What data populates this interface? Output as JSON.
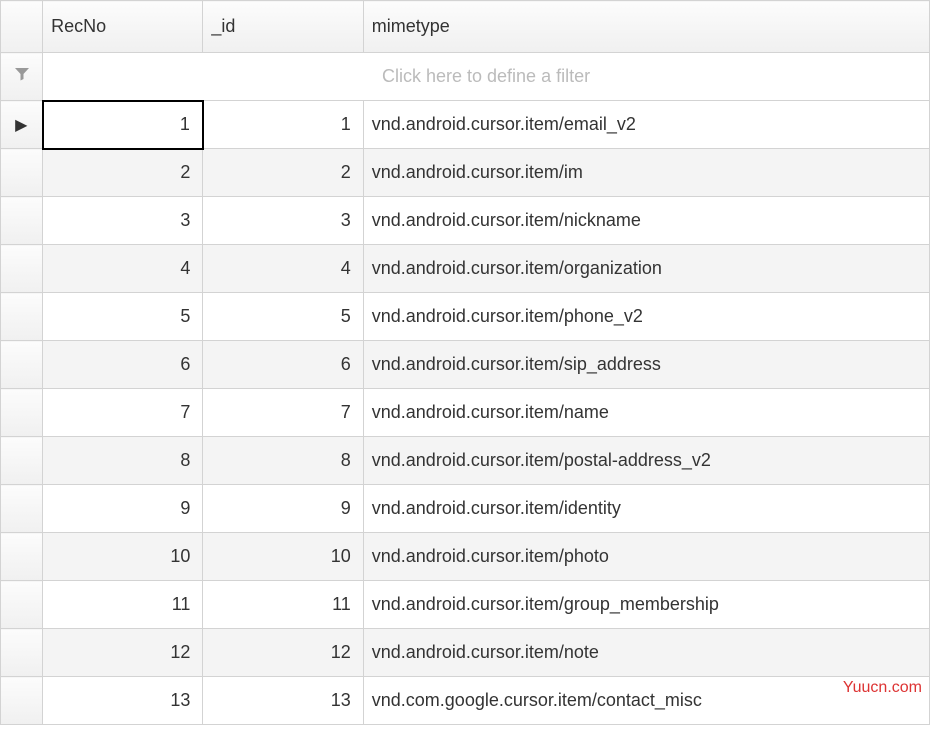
{
  "columns": {
    "recno": "RecNo",
    "id": "_id",
    "mimetype": "mimetype"
  },
  "filter": {
    "placeholder": "Click here to define a filter"
  },
  "rows": [
    {
      "recno": "1",
      "id": "1",
      "mimetype": "vnd.android.cursor.item/email_v2"
    },
    {
      "recno": "2",
      "id": "2",
      "mimetype": "vnd.android.cursor.item/im"
    },
    {
      "recno": "3",
      "id": "3",
      "mimetype": "vnd.android.cursor.item/nickname"
    },
    {
      "recno": "4",
      "id": "4",
      "mimetype": "vnd.android.cursor.item/organization"
    },
    {
      "recno": "5",
      "id": "5",
      "mimetype": "vnd.android.cursor.item/phone_v2"
    },
    {
      "recno": "6",
      "id": "6",
      "mimetype": "vnd.android.cursor.item/sip_address"
    },
    {
      "recno": "7",
      "id": "7",
      "mimetype": "vnd.android.cursor.item/name"
    },
    {
      "recno": "8",
      "id": "8",
      "mimetype": "vnd.android.cursor.item/postal-address_v2"
    },
    {
      "recno": "9",
      "id": "9",
      "mimetype": "vnd.android.cursor.item/identity"
    },
    {
      "recno": "10",
      "id": "10",
      "mimetype": "vnd.android.cursor.item/photo"
    },
    {
      "recno": "11",
      "id": "11",
      "mimetype": "vnd.android.cursor.item/group_membership"
    },
    {
      "recno": "12",
      "id": "12",
      "mimetype": "vnd.android.cursor.item/note"
    },
    {
      "recno": "13",
      "id": "13",
      "mimetype": "vnd.com.google.cursor.item/contact_misc"
    }
  ],
  "active_row_index": 0,
  "watermark": "Yuucn.com"
}
